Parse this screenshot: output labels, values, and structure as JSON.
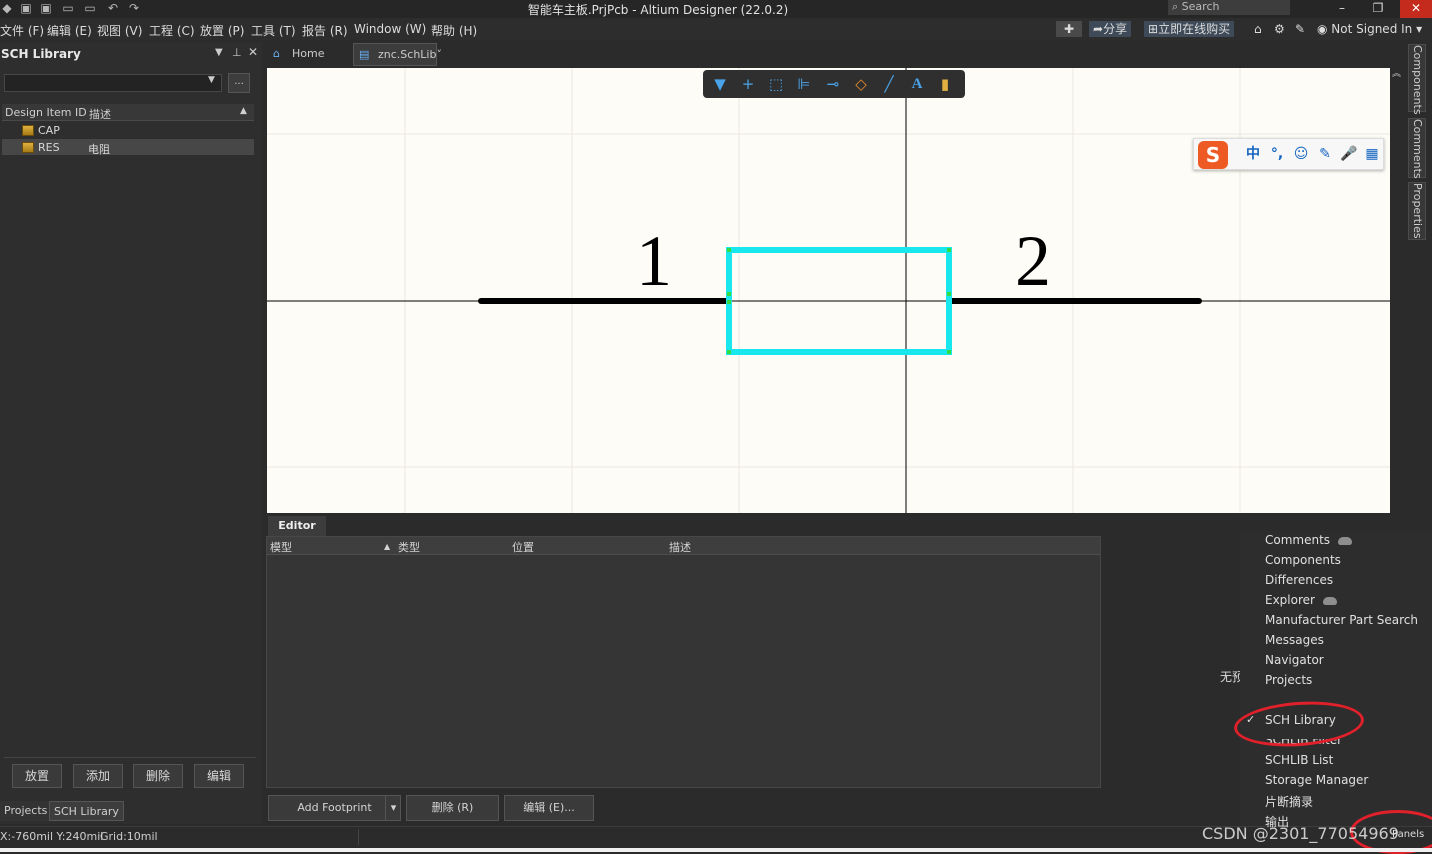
{
  "window": {
    "title": "智能车主板.PrjPcb - Altium Designer (22.0.2)",
    "search_placeholder": "Search",
    "minimize": "–",
    "maximize": "❐",
    "close": "✕"
  },
  "menu": [
    "文件 (F)",
    "编辑 (E)",
    "视图 (V)",
    "工程 (C)",
    "放置 (P)",
    "工具 (T)",
    "报告 (R)",
    "Window (W)",
    "帮助 (H)"
  ],
  "menu_right": {
    "share": "分享",
    "buy": "立即在线购买",
    "user": "Not Signed In"
  },
  "left_panel": {
    "title": "SCH Library",
    "dots": "...",
    "headers": {
      "id": "Design Item ID",
      "desc": "描述"
    },
    "rows": [
      {
        "id": "CAP",
        "desc": ""
      },
      {
        "id": "RES",
        "desc": "电阻"
      }
    ],
    "buttons": [
      "放置",
      "添加",
      "删除",
      "编辑"
    ],
    "bottom_tabs": [
      "Projects",
      "SCH Library"
    ]
  },
  "doc_tabs": [
    "Home Page",
    "znc.SchLib"
  ],
  "canvas": {
    "pin1_label": "1",
    "pin2_label": "2",
    "colors": {
      "body": "#18e8ee",
      "pin": "#000000",
      "background": "#fdfcf7"
    }
  },
  "float_toolbar_icons": [
    "filter-icon",
    "crosshair-icon",
    "select-rect-icon",
    "align-icon",
    "pin-icon",
    "eraser-icon",
    "line-icon",
    "text-icon",
    "part-icon"
  ],
  "ime_icons": [
    "sogou-logo-icon",
    "chinese-mode-icon",
    "punctuation-icon",
    "emoji-icon",
    "skin-icon",
    "mic-icon",
    "grid-icon"
  ],
  "ime": {
    "logo": "S",
    "mode": "中",
    "punct": "°,",
    "emoji": "☺",
    "skin": "✎",
    "mic": "🎤",
    "grid": "▦"
  },
  "right_tabs": [
    "Components",
    "Comments",
    "Properties"
  ],
  "editor": {
    "tab": "Editor",
    "headers": [
      "模型",
      "类型",
      "位置",
      "描述"
    ],
    "buttons": [
      "Add Footprint",
      "删除 (R)",
      "编辑 (E)..."
    ],
    "no_preview": "无预"
  },
  "status": {
    "coords": "X:-760mil Y:240mil",
    "grid": "Grid:10mil",
    "panels": "Panels"
  },
  "panels_menu": [
    {
      "label": "Comments",
      "cloud": true
    },
    {
      "label": "Components",
      "cloud": false
    },
    {
      "label": "Differences",
      "cloud": false
    },
    {
      "label": "Explorer",
      "cloud": true
    },
    {
      "label": "Manufacturer Part Search",
      "cloud": false
    },
    {
      "label": "Messages",
      "cloud": false
    },
    {
      "label": "Navigator",
      "cloud": false
    },
    {
      "label": "Projects",
      "cloud": false
    },
    {
      "label": "",
      "cloud": false
    },
    {
      "label": "SCH Library",
      "cloud": false,
      "checked": true
    },
    {
      "label": "SCHLIB Filter",
      "cloud": false
    },
    {
      "label": "SCHLIB List",
      "cloud": false
    },
    {
      "label": "Storage Manager",
      "cloud": false
    },
    {
      "label": "片断摘录",
      "cloud": false
    },
    {
      "label": "输出",
      "cloud": false
    }
  ],
  "watermark": "CSDN @2301_77054969"
}
